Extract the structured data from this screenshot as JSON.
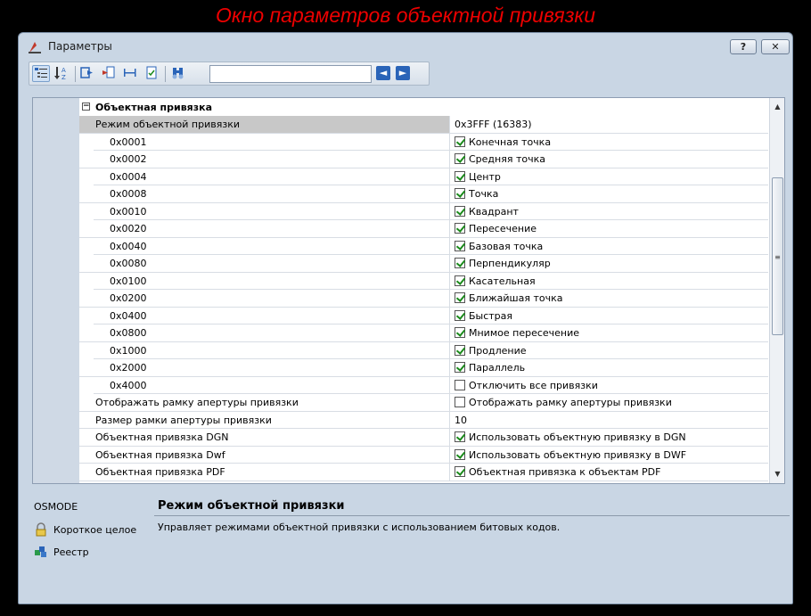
{
  "caption": "Окно параметров объектной привязки",
  "window": {
    "title": "Параметры",
    "help_label": "?",
    "close_label": "✕"
  },
  "toolbar": {
    "icons": [
      "categorized-view-icon",
      "alphabetical-view-icon",
      "export-icon",
      "import-icon",
      "dimension-icon",
      "checklist-icon",
      "find-icon"
    ],
    "search_value": "",
    "back_label": "◄",
    "forward_label": "►"
  },
  "grid": {
    "category": {
      "expander": "−",
      "title": "Объектная привязка"
    },
    "parent": {
      "expander": "−",
      "name": "Режим объектной привязки",
      "value": "0x3FFF (16383)"
    },
    "flags": [
      {
        "code": "0x0001",
        "label": "Конечная точка",
        "checked": true
      },
      {
        "code": "0x0002",
        "label": "Средняя точка",
        "checked": true
      },
      {
        "code": "0x0004",
        "label": "Центр",
        "checked": true
      },
      {
        "code": "0x0008",
        "label": "Точка",
        "checked": true
      },
      {
        "code": "0x0010",
        "label": "Квадрант",
        "checked": true
      },
      {
        "code": "0x0020",
        "label": "Пересечение",
        "checked": true
      },
      {
        "code": "0x0040",
        "label": "Базовая точка",
        "checked": true
      },
      {
        "code": "0x0080",
        "label": "Перпендикуляр",
        "checked": true
      },
      {
        "code": "0x0100",
        "label": "Касательная",
        "checked": true
      },
      {
        "code": "0x0200",
        "label": "Ближайшая точка",
        "checked": true
      },
      {
        "code": "0x0400",
        "label": "Быстрая",
        "checked": true
      },
      {
        "code": "0x0800",
        "label": "Мнимое пересечение",
        "checked": true
      },
      {
        "code": "0x1000",
        "label": "Продление",
        "checked": true
      },
      {
        "code": "0x2000",
        "label": "Параллель",
        "checked": true
      },
      {
        "code": "0x4000",
        "label": "Отключить все привязки",
        "checked": false
      }
    ],
    "others": [
      {
        "name": "Отображать рамку апертуры привязки",
        "value": "Отображать рамку апертуры привязки",
        "checkbox": true,
        "checked": false
      },
      {
        "name": "Размер рамки апертуры привязки",
        "value": "10",
        "checkbox": false,
        "checked": false
      },
      {
        "name": "Объектная привязка DGN",
        "value": "Использовать объектную привязку в DGN",
        "checkbox": true,
        "checked": true
      },
      {
        "name": "Объектная привязка Dwf",
        "value": "Использовать объектную привязку в DWF",
        "checkbox": true,
        "checked": true
      },
      {
        "name": "Объектная привязка PDF",
        "value": "Объектная привязка к объектам PDF",
        "checkbox": true,
        "checked": true
      }
    ],
    "scroll_up": "▲",
    "scroll_down": "▼",
    "scroll_grip": "≡"
  },
  "info": {
    "var_name": "OSMODE",
    "var_type": "Короткое целое",
    "var_storage": "Реестр",
    "desc_title": "Режим объектной привязки",
    "desc_text": "Управляет режимами объектной привязки с использованием битовых кодов."
  },
  "colors": {
    "caption": "#ee0000",
    "window_bg": "#c9d6e4",
    "selection": "#c8c8c8",
    "check": "#1a8a1a"
  }
}
